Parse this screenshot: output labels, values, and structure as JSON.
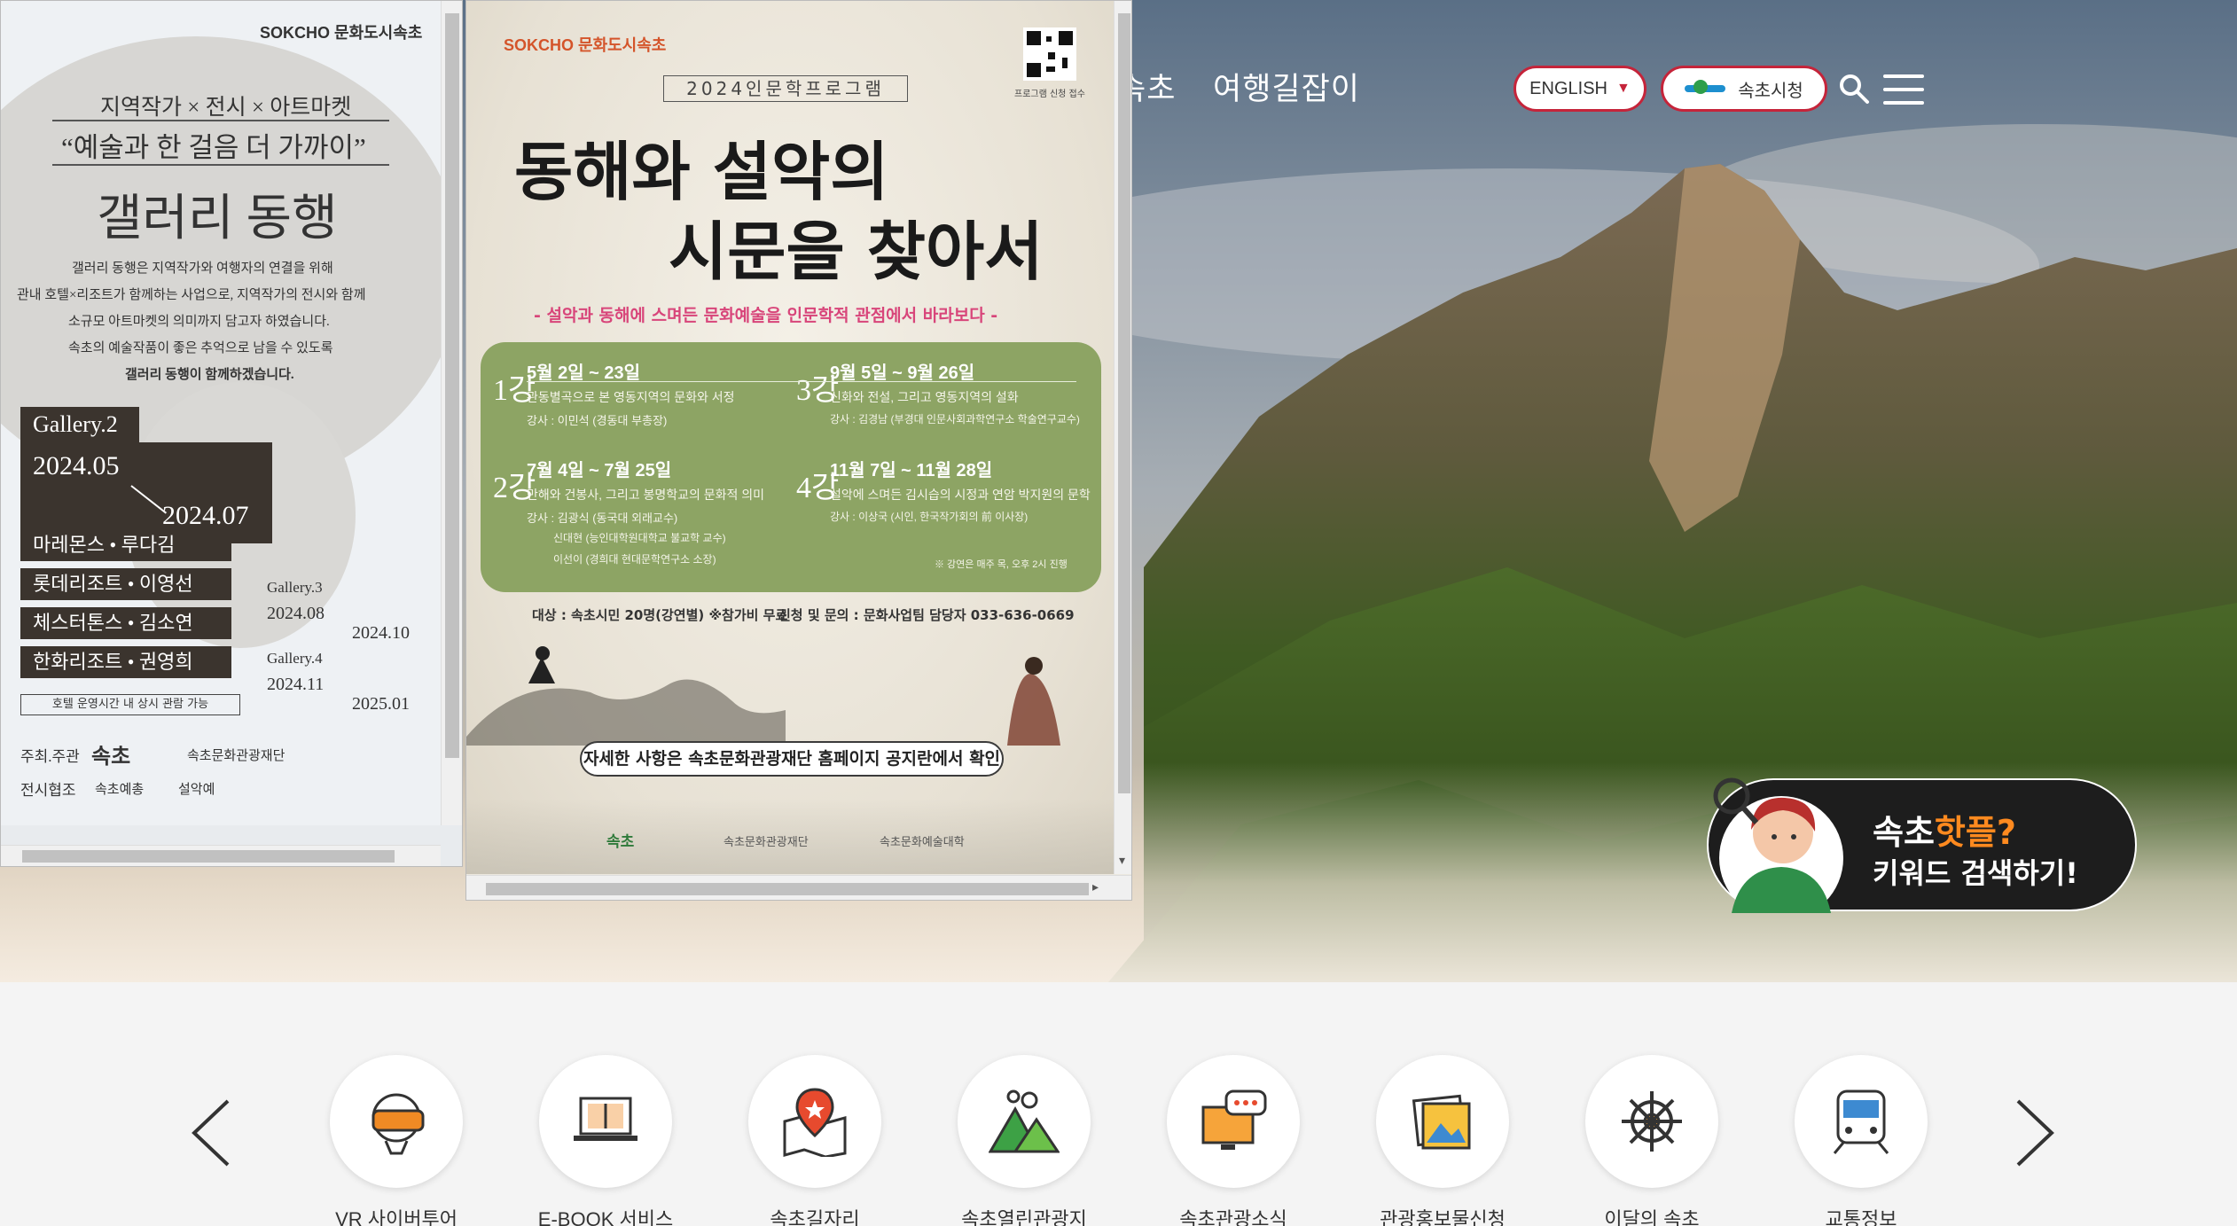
{
  "header": {
    "nav": [
      "속초",
      "여행길잡이"
    ],
    "english_button": "ENGLISH",
    "english_arrow": "▼",
    "city_hall_button": "속초시청"
  },
  "hotspot_banner": {
    "line1_prefix": "속초",
    "line1_highlight": "핫플?",
    "line2": "키워드 검색하기!"
  },
  "popup_gallery": {
    "brand": "SOKCHO 문화도시속초",
    "tagline": "지역작가 × 전시 × 아트마켓",
    "subtitle": "“예술과 한 걸음 더 가까이”",
    "title": "갤러리 동행",
    "desc": [
      "갤러리 동행은 지역작가와 여행자의 연결을 위해",
      "관내 호텔×리조트가 함께하는 사업으로, 지역작가의 전시와 함께",
      "소규모 아트마켓의 의미까지 담고자 하였습니다.",
      "속초의 예술작품이 좋은 추억으로 남을 수 있도록",
      "갤러리 동행이 함께하겠습니다."
    ],
    "gallery2_label": "Gallery.2",
    "gallery2_start": "2024.05",
    "gallery2_end": "2024.07",
    "hotels": [
      "마레몬스 • 루다김",
      "롯데리조트 • 이영선",
      "체스터톤스 • 김소연",
      "한화리조트 • 권영희"
    ],
    "note": "호텔 운영시간 내 상시 관람 가능",
    "gallery3_label": "Gallery.3",
    "gallery3_start": "2024.08",
    "gallery3_end": "2024.10",
    "gallery4_label": "Gallery.4",
    "gallery4_start": "2024.11",
    "gallery4_end": "2025.01",
    "host_label": "주최.주관",
    "host_org1": "속초",
    "host_org2": "속초문화관광재단",
    "coop_label": "전시협조",
    "coop_org1": "속초예총",
    "coop_org2": "설악예"
  },
  "popup_humanities": {
    "brand": "SOKCHO 문화도시속초",
    "qr_caption": "프로그램 신청 접수",
    "program": "2024인문학프로그램",
    "title_line1": "동해와 설악의",
    "title_line2": "시문을 찾아서",
    "subtitle": "- 설악과 동해에 스며든 문화예술을 인문학적 관점에서 바라보다 -",
    "sessions": [
      {
        "num": "1강",
        "date": "5월 2일 ~ 23일",
        "topic": "관동별곡으로 본 영동지역의 문화와 서정",
        "lecturer": "강사 : 이민석 (경동대 부총장)"
      },
      {
        "num": "3강",
        "date": "9월 5일 ~ 9월 26일",
        "topic": "신화와 전설, 그리고 영동지역의 설화",
        "lecturer": "강사 : 김경남 (부경대 인문사회과학연구소 학술연구교수)"
      },
      {
        "num": "2강",
        "date": "7월 4일 ~ 7월 25일",
        "topic": "만해와 건봉사, 그리고 봉명학교의 문화적 의미",
        "lecturer": "강사 : 김광식 (동국대 외래교수)",
        "extra1": "신대현 (능인대학원대학교 불교학 교수)",
        "extra2": "이선이 (경희대 현대문학연구소 소장)"
      },
      {
        "num": "4강",
        "date": "11월 7일 ~ 11월 28일",
        "topic": "설악에 스며든 김시습의 시정과 연암 박지원의 문학",
        "lecturer": "강사 : 이상국 (시인, 한국작가회의 前 이사장)"
      }
    ],
    "time_note": "※ 강연은 매주 목, 오후 2시 진행",
    "target": "대상 : 속초시민 20명(강연별) ※참가비 무료",
    "contact": "신청 및 문의 : 문화사업팀 담당자 033-636-0669",
    "detail": "자세한 사항은 속초문화관광재단 홈페이지 공지란에서 확인",
    "footer_org1": "속초",
    "footer_org2": "속초문화관광재단",
    "footer_org3": "속초문화예술대학"
  },
  "quick_menu": [
    {
      "label": "VR 사이버투어",
      "icon": "vr-headset-icon"
    },
    {
      "label": "E-BOOK 서비스",
      "icon": "ebook-laptop-icon"
    },
    {
      "label": "속초길자리",
      "icon": "map-pin-icon"
    },
    {
      "label": "속초열린관광지",
      "icon": "mountain-icon"
    },
    {
      "label": "속초관광소식",
      "icon": "chat-monitor-icon"
    },
    {
      "label": "관광홍보물신청",
      "icon": "picture-icon"
    },
    {
      "label": "이달의 속초",
      "icon": "ship-wheel-icon"
    },
    {
      "label": "교통정보",
      "icon": "train-icon"
    }
  ],
  "colors": {
    "accent": "#c5243a",
    "orange": "#ff8a1f",
    "green_box": "#8da464",
    "icon_orange": "#f08a24"
  }
}
